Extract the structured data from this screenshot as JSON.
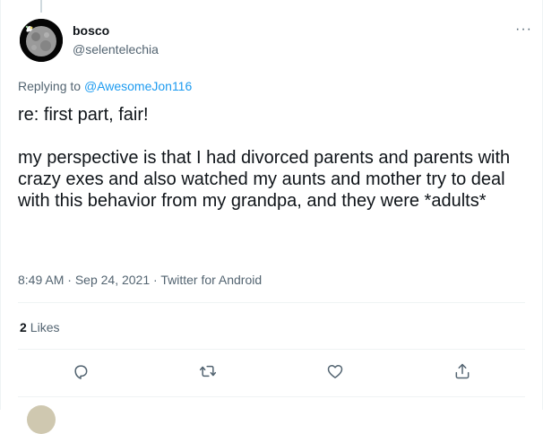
{
  "tweet": {
    "display_name": "bosco",
    "handle": "@selentelechia",
    "reply_prefix": "Replying to ",
    "reply_to": "@AwesomeJon116",
    "text_line1": "re: first part, fair!",
    "text_line2": "my perspective is that I had divorced parents and parents with crazy exes and also watched my aunts and mother try to deal with this behavior from my grandpa, and they were *adults*",
    "time": "8:49 AM",
    "date": "Sep 24, 2021",
    "source": "Twitter for Android",
    "separator": " · ",
    "likes_count": "2",
    "likes_label": "Likes"
  },
  "icons": {
    "more": "more-dots-icon",
    "reply": "reply-icon",
    "retweet": "retweet-icon",
    "like": "heart-icon",
    "share": "share-icon"
  },
  "colors": {
    "link": "#1d9bf0",
    "secondary_text": "#536471",
    "primary_text": "#0f1419",
    "divider": "#eff3f4"
  }
}
